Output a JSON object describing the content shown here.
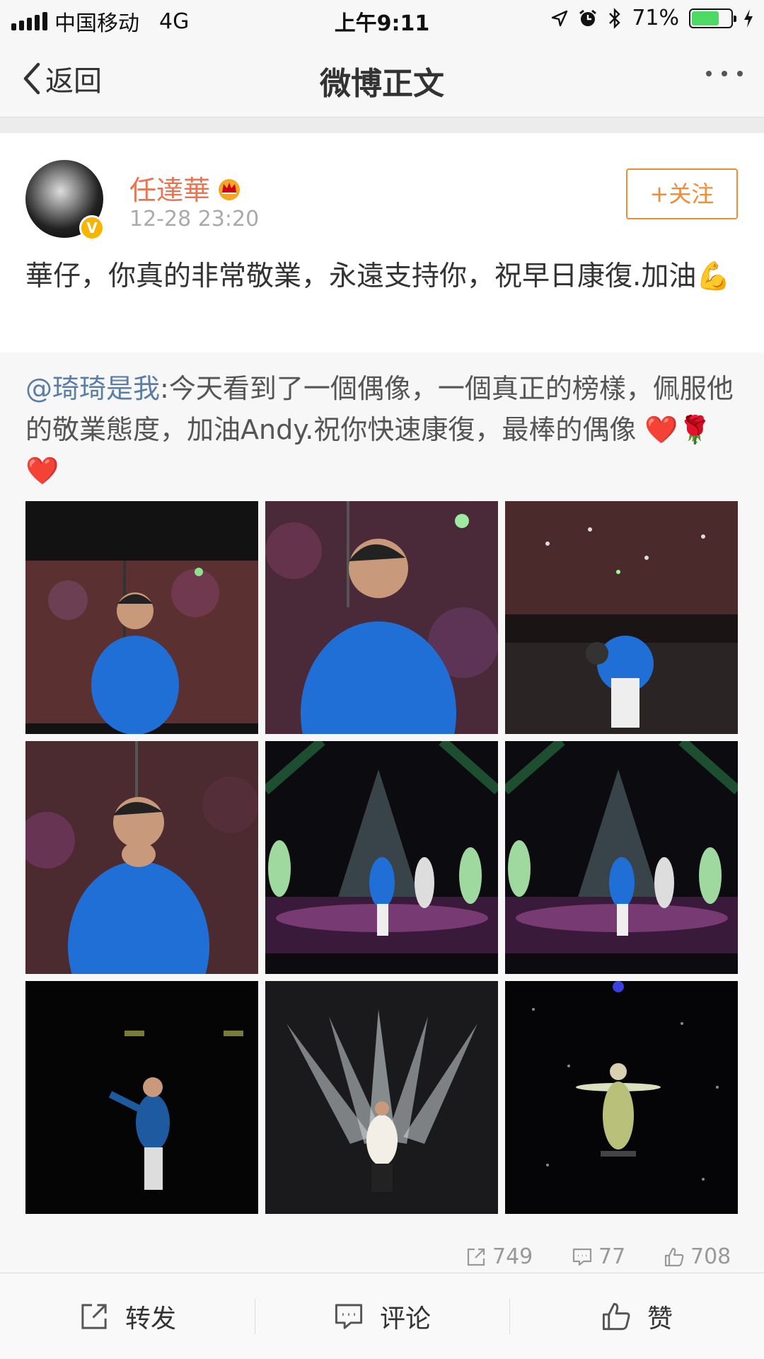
{
  "status_bar": {
    "carrier": "中国移动",
    "network": "4G",
    "time": "上午9:11",
    "battery_percent": "71%",
    "battery_level": 0.71
  },
  "nav": {
    "back_label": "返回",
    "title": "微博正文"
  },
  "post": {
    "author": "任達華",
    "time": "12-28 23:20",
    "follow_label": "+关注",
    "text": "華仔，你真的非常敬業，永遠支持你，祝早日康復.加油💪"
  },
  "repost": {
    "mention": "@琦琦是我",
    "text": ":今天看到了一個偶像，一個真正的榜樣，佩服他的敬業態度，加油Andy.祝你快速康復，最棒的偶像 ❤️🌹❤️"
  },
  "counts": {
    "reposts": "749",
    "comments": "77",
    "likes": "708"
  },
  "toolbar": {
    "repost_label": "转发",
    "comment_label": "评论",
    "like_label": "赞"
  },
  "colors": {
    "accent": "#eb7350",
    "follow": "#f28c36",
    "mention": "#5b7ea6"
  }
}
